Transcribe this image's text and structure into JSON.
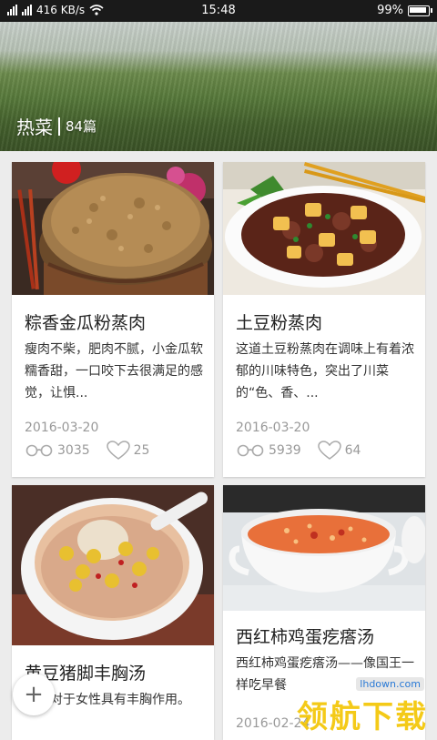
{
  "status_bar": {
    "network": "416 KB/s",
    "time": "15:48",
    "battery": "99%",
    "battery_level": 0.99
  },
  "header": {
    "title": "热菜",
    "count": "84篇"
  },
  "cards": [
    {
      "title": "粽香金瓜粉蒸肉",
      "description": "瘦肉不柴，肥肉不腻，小金瓜软糯香甜，一口咬下去很满足的感觉，让惧...",
      "date": "2016-03-20",
      "views": "3035",
      "likes": "25"
    },
    {
      "title": "土豆粉蒸肉",
      "description": "这道土豆粉蒸肉在调味上有着浓郁的川味特色，突出了川菜的“色、香、...",
      "date": "2016-03-20",
      "views": "5939",
      "likes": "64"
    },
    {
      "title": "黄豆猪脚丰胸汤",
      "description": "猪蹄对于女性具有丰胸作用。",
      "date": "",
      "views": "",
      "likes": ""
    },
    {
      "title": "西红柿鸡蛋疙瘩汤",
      "description": "西红柿鸡蛋疙瘩汤——像国王一样吃早餐",
      "date": "2016-02-24",
      "views": "",
      "likes": ""
    }
  ],
  "fab": {
    "label": "+"
  },
  "watermark": {
    "text": "领航下载",
    "url": "lhdown.com"
  },
  "icons": [
    "signal-icon",
    "wifi-icon",
    "battery-icon",
    "glasses-icon",
    "heart-icon",
    "plus-icon"
  ]
}
